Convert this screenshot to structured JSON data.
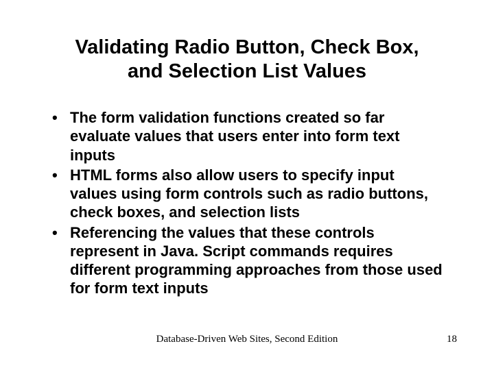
{
  "title_line1": "Validating Radio Button, Check Box,",
  "title_line2": "and Selection List Values",
  "bullets": [
    "The form validation functions created so far evaluate values that users enter into form text inputs",
    "HTML forms also allow users to specify input values using form controls such as radio buttons, check boxes, and selection lists",
    "Referencing the values that these controls represent in Java. Script commands requires different programming approaches from those used for form text inputs"
  ],
  "footer_center": "Database-Driven Web Sites, Second Edition",
  "footer_right": "18"
}
